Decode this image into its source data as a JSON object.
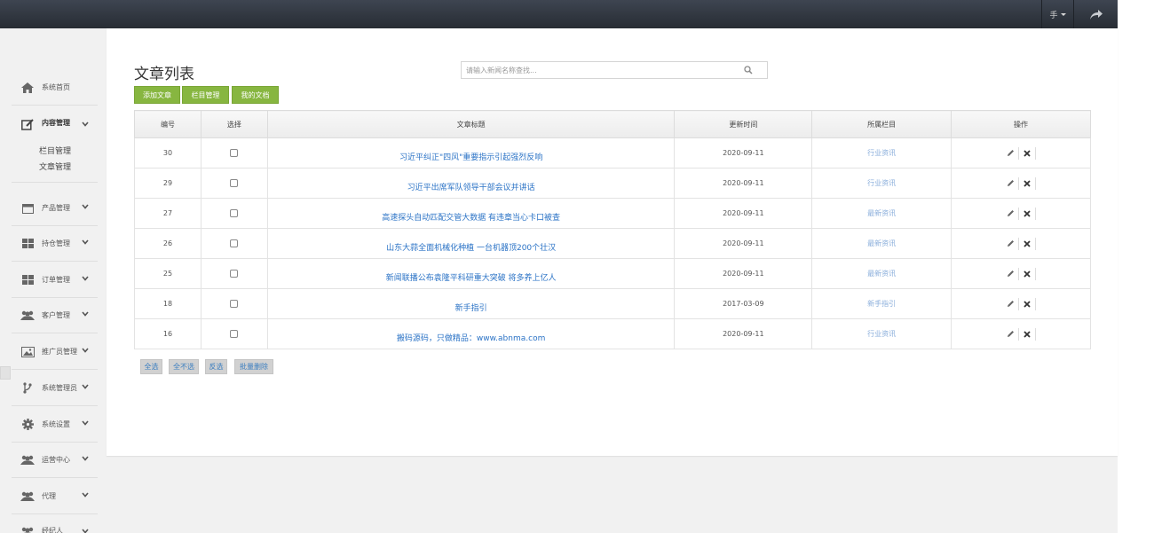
{
  "topbar": {
    "user_label": "手"
  },
  "sidebar": {
    "items": [
      {
        "label": "系统首页",
        "icon": "home-icon"
      },
      {
        "label": "内容管理",
        "icon": "edit-icon"
      },
      {
        "label": "产品管理",
        "icon": "calendar-icon"
      },
      {
        "label": "持仓管理",
        "icon": "grid-icon"
      },
      {
        "label": "订单管理",
        "icon": "grid-icon"
      },
      {
        "label": "客户管理",
        "icon": "users-icon"
      },
      {
        "label": "推广员管理",
        "icon": "picture-icon"
      },
      {
        "label": "系统管理员",
        "icon": "branch-icon"
      },
      {
        "label": "系统设置",
        "icon": "gear-icon"
      },
      {
        "label": "运营中心",
        "icon": "users-icon"
      },
      {
        "label": "代理",
        "icon": "users-icon"
      },
      {
        "label": "经纪人",
        "icon": "users-icon"
      }
    ],
    "sub_items": [
      "栏目管理",
      "文章管理"
    ]
  },
  "main": {
    "title": "文章列表",
    "search_placeholder": "请输入新闻名称查找...",
    "buttons": [
      "添加文章",
      "栏目管理",
      "我的文档"
    ],
    "columns": [
      "编号",
      "选择",
      "文章标题",
      "更新时间",
      "所属栏目",
      "操作"
    ],
    "rows": [
      {
        "id": "30",
        "title": "习近平纠正\"四风\"重要指示引起强烈反响",
        "date": "2020-09-11",
        "category": "行业资讯"
      },
      {
        "id": "29",
        "title": "习近平出席军队领导干部会议并讲话",
        "date": "2020-09-11",
        "category": "行业资讯"
      },
      {
        "id": "27",
        "title": "高速探头自动匹配交管大数据 有违章当心卡口被查",
        "date": "2020-09-11",
        "category": "最新资讯"
      },
      {
        "id": "26",
        "title": "山东大蒜全面机械化种植 一台机器顶200个壮汉",
        "date": "2020-09-11",
        "category": "最新资讯"
      },
      {
        "id": "25",
        "title": "新闻联播公布袁隆平科研重大突破 将多养上亿人",
        "date": "2020-09-11",
        "category": "最新资讯"
      },
      {
        "id": "18",
        "title": "新手指引",
        "date": "2017-03-09",
        "category": "新手指引"
      },
      {
        "id": "16",
        "title": "搬码源码，只做精品：www.abnma.com",
        "date": "2020-09-11",
        "category": "行业资讯"
      }
    ],
    "bulk_buttons": [
      "全选",
      "全不选",
      "反选",
      "批量删除"
    ]
  },
  "colors": {
    "accent_green": "#87b640",
    "link_blue": "#2b73c6",
    "topbar": "#2f343c"
  }
}
